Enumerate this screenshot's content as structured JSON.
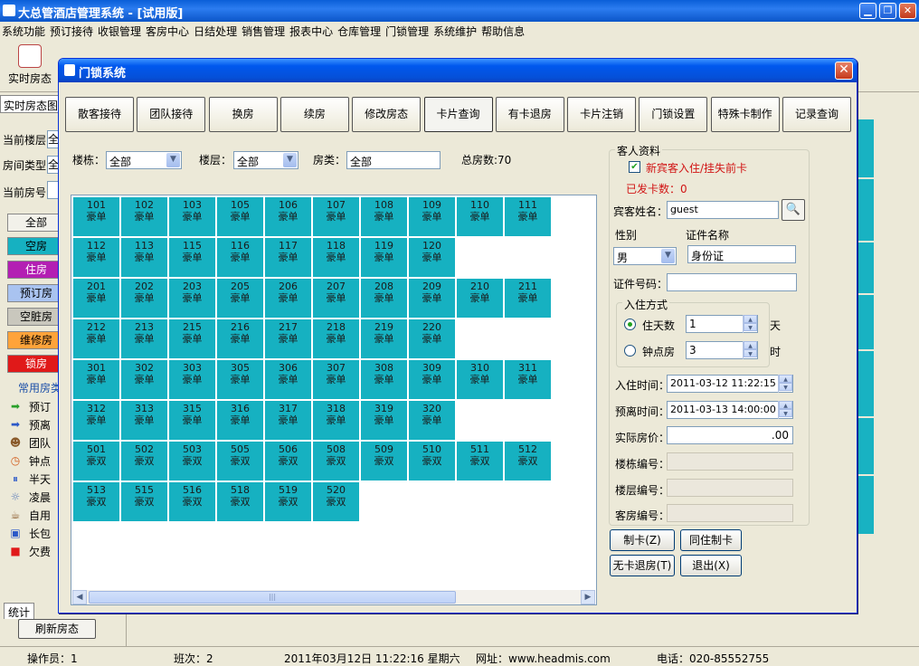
{
  "app": {
    "title": "大总管酒店管理系统 - [试用版]",
    "minimize": "▁",
    "restore": "❐",
    "close": "✕"
  },
  "menu": [
    "系统功能",
    "预订接待",
    "收银管理",
    "客房中心",
    "日结处理",
    "销售管理",
    "报表中心",
    "仓库管理",
    "门锁管理",
    "系统维护",
    "帮助信息"
  ],
  "toolbar": {
    "first_label": "实时房态"
  },
  "left": {
    "tab": "实时房态图",
    "floor_label": "当前楼层",
    "floor_value": "全",
    "type_label": "房间类型",
    "type_value": "全",
    "room_label": "当前房号",
    "status_buttons": [
      {
        "label": "全部",
        "color": "#f2f1ea",
        "mark": "#0a7a2a"
      },
      {
        "label": "空房",
        "color": "#16b1c1",
        "mark": "#0a7a2a"
      },
      {
        "label": "住房",
        "color": "#b31fb3",
        "mark": "#0a7a2a"
      },
      {
        "label": "预订房",
        "color": "#a9c3f0",
        "mark": "#0a7a2a"
      },
      {
        "label": "空脏房",
        "color": "#c9c7bd",
        "mark": "#0a7a2a"
      },
      {
        "label": "维修房",
        "color": "#ffa33a",
        "mark": "#0a7a2a"
      },
      {
        "label": "锁房",
        "color": "#e01919",
        "mark": "#0a7a2a"
      }
    ],
    "legend_title": "常用房类",
    "legend": [
      {
        "label": "预订",
        "icon": "arrow-right-icon",
        "glyph": "➡",
        "color": "#2aa02a"
      },
      {
        "label": "预离",
        "icon": "arrow-right-icon",
        "glyph": "➡",
        "color": "#2b58c8"
      },
      {
        "label": "团队",
        "icon": "group-icon",
        "glyph": "☻",
        "color": "#8a5a2a"
      },
      {
        "label": "钟点",
        "icon": "clock-icon",
        "glyph": "◷",
        "color": "#d25a18"
      },
      {
        "label": "半天",
        "icon": "pause-icon",
        "glyph": "⏸",
        "color": "#2b58c8"
      },
      {
        "label": "凌晨",
        "icon": "bulb-icon",
        "glyph": "☼",
        "color": "#5a7ab8"
      },
      {
        "label": "自用",
        "icon": "cup-icon",
        "glyph": "☕",
        "color": "#8a5a2a"
      },
      {
        "label": "长包",
        "icon": "package-icon",
        "glyph": "▣",
        "color": "#2b58c8"
      },
      {
        "label": "欠费",
        "icon": "square-icon",
        "glyph": "■",
        "color": "#e01919"
      }
    ],
    "stat_tab": "统计",
    "refresh": "刷新房态"
  },
  "status": {
    "operator": "操作员：1",
    "shift": "班次：2",
    "datetime": "2011年03月12日 11:22:16  星期六",
    "web": "网址：www.headmis.com",
    "phone": "电话：020-85552755"
  },
  "dialog": {
    "title": "门锁系统",
    "close": "✕",
    "buttons": [
      "散客接待",
      "团队接待",
      "换房",
      "续房",
      "修改房态",
      "卡片查询",
      "有卡退房",
      "卡片注销",
      "门锁设置",
      "特殊卡制作",
      "记录查询"
    ],
    "active_button": 5,
    "filter": {
      "building_label": "楼栋：",
      "building_value": "全部",
      "floor_label": "楼层：",
      "floor_value": "全部",
      "type_label": "房类：",
      "type_value": "全部",
      "total": "总房数:70"
    },
    "room_rows": [
      [
        [
          "101",
          "豪单"
        ],
        [
          "102",
          "豪单"
        ],
        [
          "103",
          "豪单"
        ],
        [
          "105",
          "豪单"
        ],
        [
          "106",
          "豪单"
        ],
        [
          "107",
          "豪单"
        ],
        [
          "108",
          "豪单"
        ],
        [
          "109",
          "豪单"
        ],
        [
          "110",
          "豪单"
        ],
        [
          "111",
          "豪单"
        ]
      ],
      [
        [
          "112",
          "豪单"
        ],
        [
          "113",
          "豪单"
        ],
        [
          "115",
          "豪单"
        ],
        [
          "116",
          "豪单"
        ],
        [
          "117",
          "豪单"
        ],
        [
          "118",
          "豪单"
        ],
        [
          "119",
          "豪单"
        ],
        [
          "120",
          "豪单"
        ]
      ],
      [
        [
          "201",
          "豪单"
        ],
        [
          "202",
          "豪单"
        ],
        [
          "203",
          "豪单"
        ],
        [
          "205",
          "豪单"
        ],
        [
          "206",
          "豪单"
        ],
        [
          "207",
          "豪单"
        ],
        [
          "208",
          "豪单"
        ],
        [
          "209",
          "豪单"
        ],
        [
          "210",
          "豪单"
        ],
        [
          "211",
          "豪单"
        ]
      ],
      [
        [
          "212",
          "豪单"
        ],
        [
          "213",
          "豪单"
        ],
        [
          "215",
          "豪单"
        ],
        [
          "216",
          "豪单"
        ],
        [
          "217",
          "豪单"
        ],
        [
          "218",
          "豪单"
        ],
        [
          "219",
          "豪单"
        ],
        [
          "220",
          "豪单"
        ]
      ],
      [
        [
          "301",
          "豪单"
        ],
        [
          "302",
          "豪单"
        ],
        [
          "303",
          "豪单"
        ],
        [
          "305",
          "豪单"
        ],
        [
          "306",
          "豪单"
        ],
        [
          "307",
          "豪单"
        ],
        [
          "308",
          "豪单"
        ],
        [
          "309",
          "豪单"
        ],
        [
          "310",
          "豪单"
        ],
        [
          "311",
          "豪单"
        ]
      ],
      [
        [
          "312",
          "豪单"
        ],
        [
          "313",
          "豪单"
        ],
        [
          "315",
          "豪单"
        ],
        [
          "316",
          "豪单"
        ],
        [
          "317",
          "豪单"
        ],
        [
          "318",
          "豪单"
        ],
        [
          "319",
          "豪单"
        ],
        [
          "320",
          "豪单"
        ]
      ],
      [
        [
          "501",
          "豪双"
        ],
        [
          "502",
          "豪双"
        ],
        [
          "503",
          "豪双"
        ],
        [
          "505",
          "豪双"
        ],
        [
          "506",
          "豪双"
        ],
        [
          "508",
          "豪双"
        ],
        [
          "509",
          "豪双"
        ],
        [
          "510",
          "豪双"
        ],
        [
          "511",
          "豪双"
        ],
        [
          "512",
          "豪双"
        ]
      ],
      [
        [
          "513",
          "豪双"
        ],
        [
          "515",
          "豪双"
        ],
        [
          "516",
          "豪双"
        ],
        [
          "518",
          "豪双"
        ],
        [
          "519",
          "豪双"
        ],
        [
          "520",
          "豪双"
        ]
      ]
    ],
    "guest": {
      "group_title": "客人资料",
      "new_guest_label": "新宾客入住/挂失前卡",
      "new_guest_checked": true,
      "issued_label": "已发卡数：0",
      "name_label": "宾客姓名：",
      "name_value": "guest",
      "gender_label": "性别",
      "gender_value": "男",
      "id_type_label": "证件名称",
      "id_type_value": "身份证",
      "id_no_label": "证件号码：",
      "id_no_value": "",
      "mode_title": "入住方式",
      "days_label": "住天数",
      "days_value": "1",
      "days_unit": "天",
      "hours_label": "钟点房",
      "hours_value": "3",
      "hours_unit": "时",
      "checkin_label": "入住时间：",
      "checkin_value": "2011-03-12 11:22:15",
      "checkout_label": "预离时间：",
      "checkout_value": "2011-03-13 14:00:00",
      "price_label": "实际房价：",
      "price_value": ".00",
      "building_no_label": "楼栋编号：",
      "floor_no_label": "楼层编号：",
      "room_no_label": "客房编号："
    },
    "actions": {
      "make_card": "制卡(Z)",
      "same_room_card": "同住制卡",
      "no_card_checkout": "无卡退房(T)",
      "exit": "退出(X)"
    }
  },
  "colors": {
    "vacant": "#16b1c1",
    "title_bar": "#0058ee",
    "red_text": "#d11414"
  }
}
